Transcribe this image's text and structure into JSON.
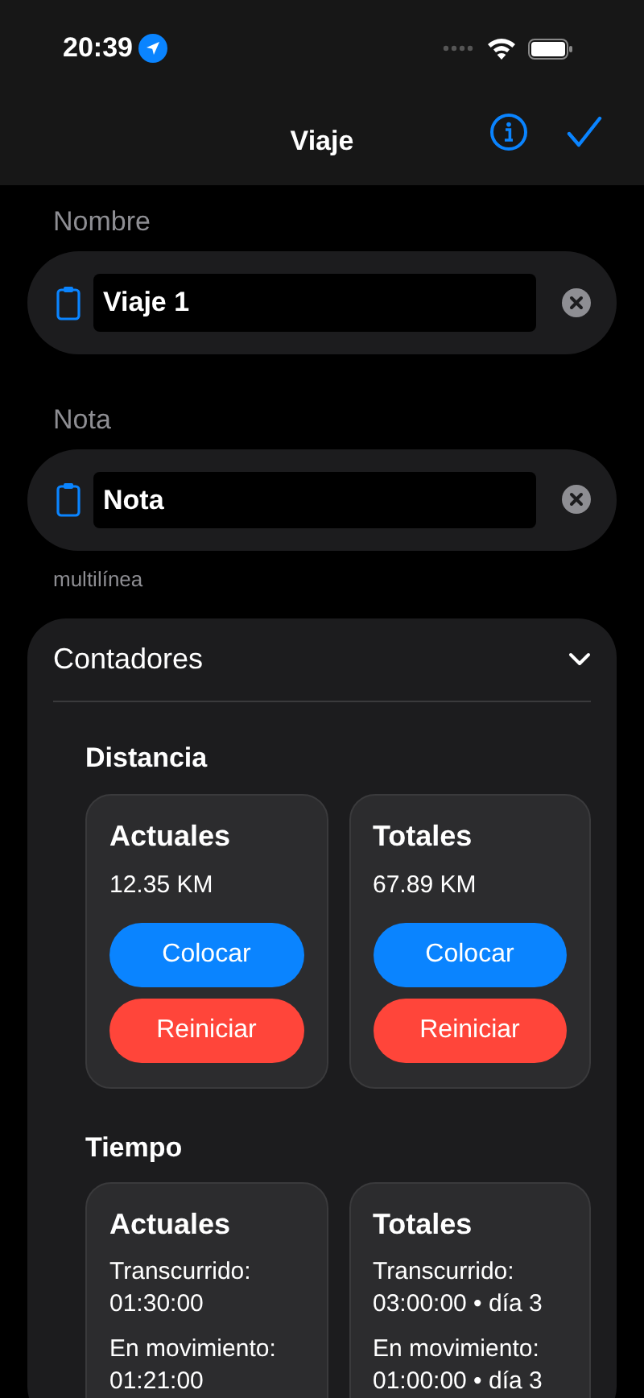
{
  "status_bar": {
    "time": "20:39"
  },
  "nav": {
    "title": "Viaje"
  },
  "fields": [
    {
      "label": "Nombre",
      "value": "Viaje 1"
    },
    {
      "label": "Nota",
      "value": "Nota",
      "footer": "multilínea"
    }
  ],
  "counters": {
    "title": "Contadores",
    "expanded": true,
    "sections": [
      {
        "title": "Distancia",
        "kind": "distance",
        "cards": [
          {
            "title": "Actuales",
            "value": "12.35 KM",
            "buttons": [
              "Colocar",
              "Reiniciar"
            ]
          },
          {
            "title": "Totales",
            "value": "67.89 KM",
            "buttons": [
              "Colocar",
              "Reiniciar"
            ]
          }
        ]
      },
      {
        "title": "Tiempo",
        "kind": "time",
        "cards": [
          {
            "title": "Actuales",
            "lines": [
              {
                "label": "Transcurrido:",
                "value": "01:30:00"
              },
              {
                "label": "En movimiento:",
                "value": "01:21:00"
              }
            ]
          },
          {
            "title": "Totales",
            "lines": [
              {
                "label": "Transcurrido:",
                "value": "03:00:00 • día 3"
              },
              {
                "label": "En movimiento:",
                "value": "01:00:00 • día 3"
              }
            ]
          }
        ]
      }
    ]
  }
}
